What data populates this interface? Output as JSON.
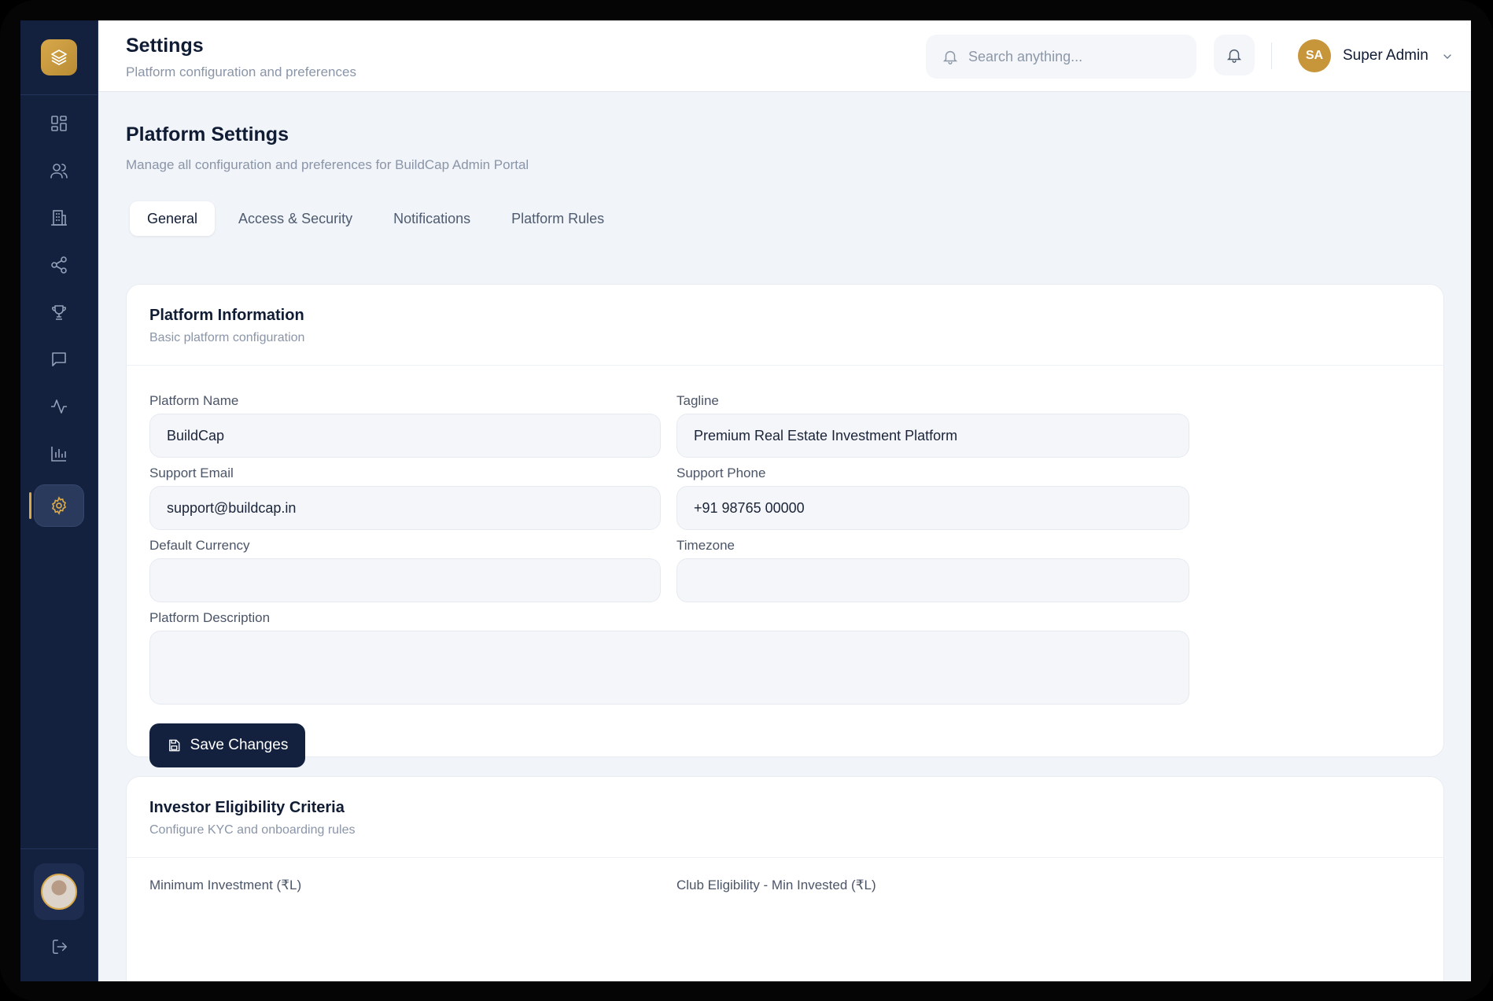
{
  "header": {
    "title": "Settings",
    "subtitle": "Platform configuration and preferences",
    "search_placeholder": "Search anything...",
    "user_initials": "SA",
    "user_name": "Super Admin"
  },
  "sidebar": {
    "items": [
      {
        "icon": "dashboard-icon"
      },
      {
        "icon": "users-icon"
      },
      {
        "icon": "building-icon"
      },
      {
        "icon": "share-icon"
      },
      {
        "icon": "trophy-icon"
      },
      {
        "icon": "message-icon"
      },
      {
        "icon": "activity-icon"
      },
      {
        "icon": "bar-chart-icon"
      },
      {
        "icon": "settings-icon",
        "active": true
      }
    ]
  },
  "page": {
    "title": "Platform Settings",
    "subtitle": "Manage all configuration and preferences for BuildCap Admin Portal"
  },
  "tabs": [
    {
      "label": "General",
      "active": true
    },
    {
      "label": "Access & Security"
    },
    {
      "label": "Notifications"
    },
    {
      "label": "Platform Rules"
    }
  ],
  "platform_info": {
    "title": "Platform Information",
    "subtitle": "Basic platform configuration",
    "fields": {
      "platform_name": {
        "label": "Platform Name",
        "value": "BuildCap"
      },
      "tagline": {
        "label": "Tagline",
        "value": "Premium Real Estate Investment Platform"
      },
      "support_email": {
        "label": "Support Email",
        "value": "support@buildcap.in"
      },
      "support_phone": {
        "label": "Support Phone",
        "value": "+91 98765 00000"
      },
      "default_currency": {
        "label": "Default Currency",
        "value": ""
      },
      "timezone": {
        "label": "Timezone",
        "value": ""
      },
      "description": {
        "label": "Platform Description",
        "value": ""
      }
    },
    "save_label": "Save Changes"
  },
  "eligibility": {
    "title": "Investor Eligibility Criteria",
    "subtitle": "Configure KYC and onboarding rules",
    "min_investment_label": "Minimum Investment (₹L)",
    "club_eligibility_label": "Club Eligibility - Min Invested (₹L)"
  },
  "colors": {
    "sidebar_bg": "#13213f",
    "accent_gold": "#d8a84a",
    "primary_button": "#13213f",
    "page_bg": "#f1f4f8"
  }
}
